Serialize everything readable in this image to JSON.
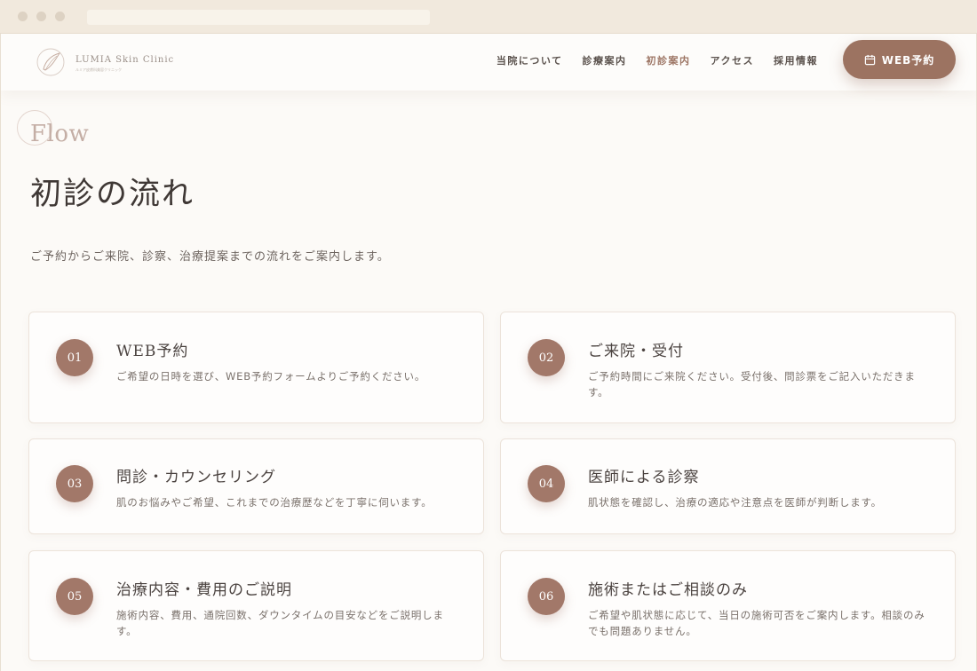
{
  "logo": {
    "name": "LUMIA Skin Clinic",
    "sub": "ルミア皮膚科美容クリニック"
  },
  "nav": {
    "items": [
      {
        "label": "当院について",
        "name": "nav-about"
      },
      {
        "label": "診療案内",
        "name": "nav-treatment"
      },
      {
        "label": "初診案内",
        "name": "nav-first-visit"
      },
      {
        "label": "アクセス",
        "name": "nav-access"
      },
      {
        "label": "採用情報",
        "name": "nav-recruit"
      }
    ],
    "active": "初診案内",
    "cta_label": "WEB予約"
  },
  "hero": {
    "eyebrow": "Flow",
    "title": "初診の流れ",
    "lead": "ご予約からご来院、診察、治療提案までの流れをご案内します。"
  },
  "steps": [
    {
      "num": "01",
      "title": "WEB予約",
      "desc": "ご希望の日時を選び、WEB予約フォームよりご予約ください。"
    },
    {
      "num": "02",
      "title": "ご来院・受付",
      "desc": "ご予約時間にご来院ください。受付後、問診票をご記入いただきます。"
    },
    {
      "num": "03",
      "title": "問診・カウンセリング",
      "desc": "肌のお悩みやご希望、これまでの治療歴などを丁寧に伺います。"
    },
    {
      "num": "04",
      "title": "医師による診察",
      "desc": "肌状態を確認し、治療の適応や注意点を医師が判断します。"
    },
    {
      "num": "05",
      "title": "治療内容・費用のご説明",
      "desc": "施術内容、費用、通院回数、ダウンタイムの目安などをご説明します。"
    },
    {
      "num": "06",
      "title": "施術またはご相談のみ",
      "desc": "ご希望や肌状態に応じて、当日の施術可否をご案内します。相談のみでも問題ありません。"
    }
  ],
  "colors": {
    "accent": "#9c7361",
    "number_badge": "#a27869",
    "background": "#fcfaf7"
  }
}
